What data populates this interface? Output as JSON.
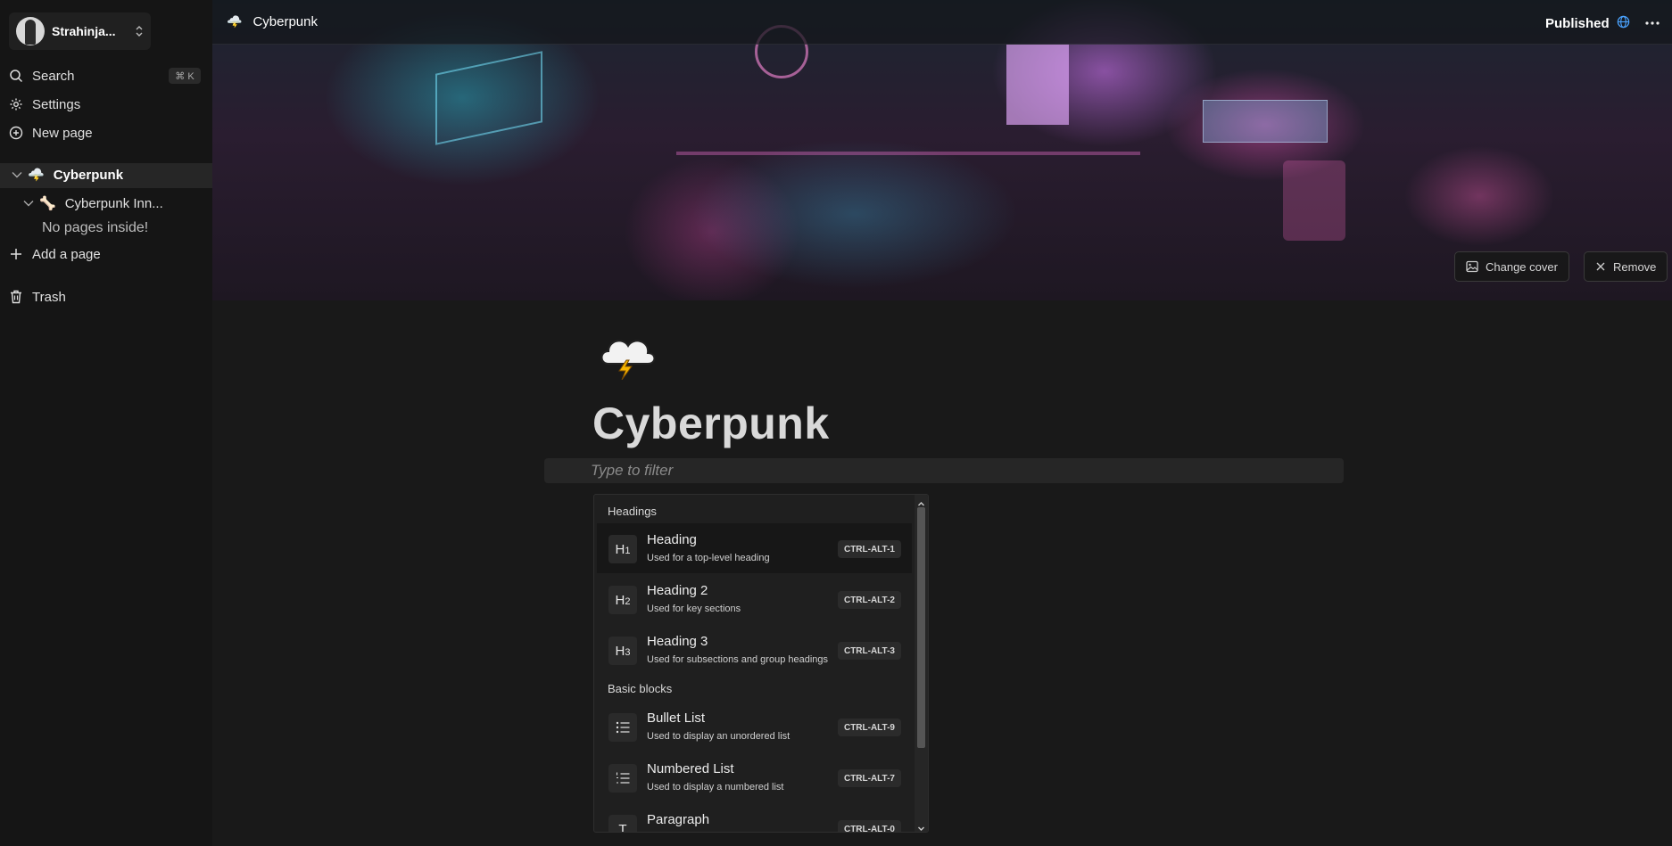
{
  "workspace": {
    "name": "Strahinja..."
  },
  "sidebar": {
    "search_label": "Search",
    "search_shortcut": "⌘ K",
    "settings_label": "Settings",
    "new_page_label": "New page",
    "tree": {
      "root": {
        "emoji": "🌩️",
        "label": "Cyberpunk"
      },
      "child": {
        "emoji": "🦴",
        "label": "Cyberpunk Inn..."
      },
      "empty_note": "No pages inside!"
    },
    "add_page_label": "Add a page",
    "trash_label": "Trash"
  },
  "topbar": {
    "breadcrumb_emoji": "🌩️",
    "breadcrumb_label": "Cyberpunk",
    "published_label": "Published"
  },
  "cover": {
    "change_cover_label": "Change cover",
    "remove_label": "Remove"
  },
  "page": {
    "emoji": "🌩️",
    "title": "Cyberpunk",
    "filter_placeholder": "Type to filter"
  },
  "slash_menu": {
    "groups": [
      {
        "label": "Headings",
        "items": [
          {
            "icon": "H1",
            "title": "Heading",
            "desc": "Used for a top-level heading",
            "shortcut": "CTRL-ALT-1"
          },
          {
            "icon": "H2",
            "title": "Heading 2",
            "desc": "Used for key sections",
            "shortcut": "CTRL-ALT-2"
          },
          {
            "icon": "H3",
            "title": "Heading 3",
            "desc": "Used for subsections and group headings",
            "shortcut": "CTRL-ALT-3"
          }
        ]
      },
      {
        "label": "Basic blocks",
        "items": [
          {
            "icon": "bullet-list-icon",
            "title": "Bullet List",
            "desc": "Used to display an unordered list",
            "shortcut": "CTRL-ALT-9"
          },
          {
            "icon": "numbered-list-icon",
            "title": "Numbered List",
            "desc": "Used to display a numbered list",
            "shortcut": "CTRL-ALT-7"
          },
          {
            "icon": "T",
            "title": "Paragraph",
            "desc": "",
            "shortcut": "CTRL-ALT-0"
          }
        ]
      }
    ]
  },
  "colors": {
    "accent_globe": "#4aa3ff",
    "background": "#191919",
    "sidebar": "#151515"
  }
}
